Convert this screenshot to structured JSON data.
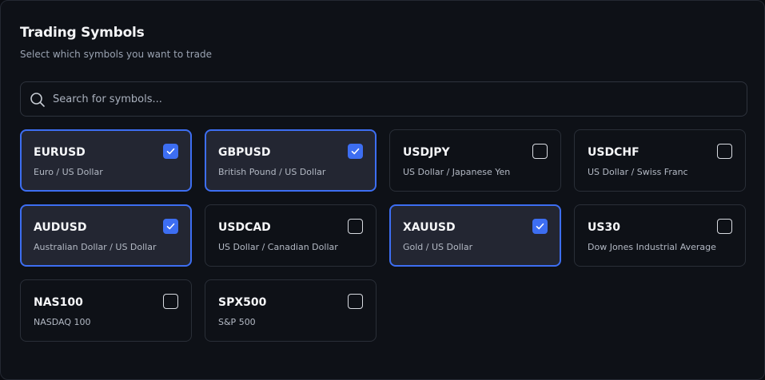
{
  "header": {
    "title": "Trading Symbols",
    "subtitle": "Select which symbols you want to trade"
  },
  "search": {
    "placeholder": "Search for symbols...",
    "value": ""
  },
  "colors": {
    "accent": "#3d6ef2",
    "background": "#0e1117",
    "selected_card": "#232632"
  },
  "symbols": [
    {
      "symbol": "EURUSD",
      "name": "Euro / US Dollar",
      "selected": true
    },
    {
      "symbol": "GBPUSD",
      "name": "British Pound / US Dollar",
      "selected": true
    },
    {
      "symbol": "USDJPY",
      "name": "US Dollar / Japanese Yen",
      "selected": false
    },
    {
      "symbol": "USDCHF",
      "name": "US Dollar / Swiss Franc",
      "selected": false
    },
    {
      "symbol": "AUDUSD",
      "name": "Australian Dollar / US Dollar",
      "selected": true
    },
    {
      "symbol": "USDCAD",
      "name": "US Dollar / Canadian Dollar",
      "selected": false
    },
    {
      "symbol": "XAUUSD",
      "name": "Gold / US Dollar",
      "selected": true
    },
    {
      "symbol": "US30",
      "name": "Dow Jones Industrial Average",
      "selected": false
    },
    {
      "symbol": "NAS100",
      "name": "NASDAQ 100",
      "selected": false
    },
    {
      "symbol": "SPX500",
      "name": "S&P 500",
      "selected": false
    }
  ]
}
